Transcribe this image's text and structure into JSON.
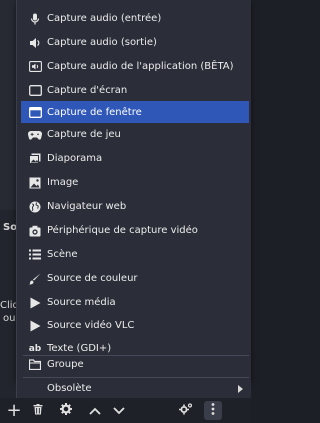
{
  "menu": {
    "items": [
      {
        "label": "Capture audio (entrée)",
        "icon": "microphone-icon"
      },
      {
        "label": "Capture audio (sortie)",
        "icon": "speaker-icon"
      },
      {
        "label": "Capture audio de l'application (BÊTA)",
        "icon": "app-audio-icon"
      },
      {
        "label": "Capture d'écran",
        "icon": "monitor-icon"
      },
      {
        "label": "Capture de fenêtre",
        "icon": "window-icon",
        "selected": true
      },
      {
        "label": "Capture de jeu",
        "icon": "gamepad-icon"
      },
      {
        "label": "Diaporama",
        "icon": "slideshow-icon"
      },
      {
        "label": "Image",
        "icon": "image-icon"
      },
      {
        "label": "Navigateur web",
        "icon": "globe-icon"
      },
      {
        "label": "Périphérique de capture vidéo",
        "icon": "camera-icon"
      },
      {
        "label": "Scène",
        "icon": "list-icon"
      },
      {
        "label": "Source de couleur",
        "icon": "brush-icon"
      },
      {
        "label": "Source média",
        "icon": "play-icon"
      },
      {
        "label": "Source vidéo VLC",
        "icon": "play-icon"
      },
      {
        "label": "Texte (GDI+)",
        "icon": "text-icon"
      }
    ],
    "group_label": "Groupe",
    "deprecated_label": "Obsolète"
  },
  "background": {
    "panel_label": "So",
    "hint_line1": "Cliqu",
    "hint_line2": "ou"
  },
  "colors": {
    "menu_bg": "#2b2e38",
    "selected_bg": "#2f57b8",
    "app_bg": "#1d1f26"
  }
}
